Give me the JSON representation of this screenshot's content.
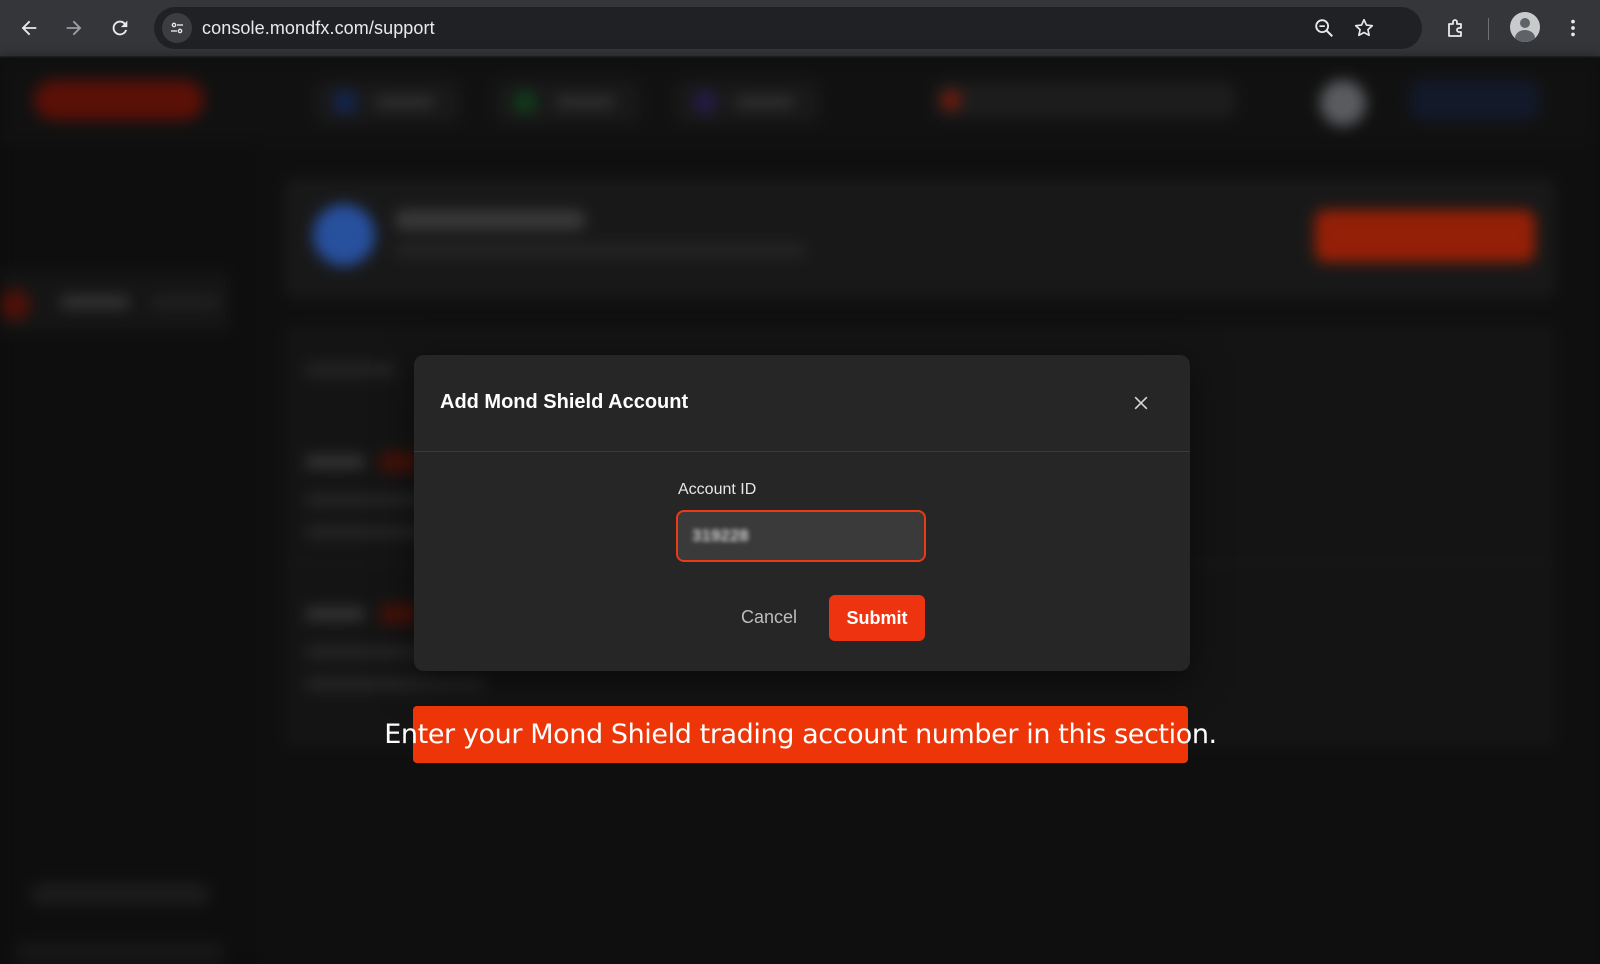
{
  "browser": {
    "url": "console.mondfx.com/support",
    "icons": {
      "back": "back-arrow-icon",
      "forward": "forward-arrow-icon",
      "reload": "reload-icon",
      "site_info": "site-settings-icon",
      "zoom": "zoom-icon",
      "bookmark": "star-icon",
      "extensions": "puzzle-icon",
      "profile": "avatar-icon",
      "menu": "kebab-menu-icon"
    }
  },
  "modal": {
    "title": "Add Mond Shield Account",
    "field_label": "Account ID",
    "field_value": "319228",
    "cancel_label": "Cancel",
    "submit_label": "Submit"
  },
  "callout": {
    "text": "Enter your Mond Shield trading account number in this section."
  },
  "colors": {
    "accent": "#ee3311",
    "modal_bg": "#262626",
    "chrome_bg": "#35363a"
  }
}
